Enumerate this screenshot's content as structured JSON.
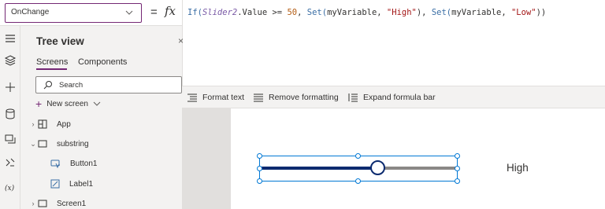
{
  "formula_bar": {
    "property": "OnChange",
    "equals": "=",
    "fx": "fx",
    "formula_tokens": [
      {
        "text": "If(",
        "style": "kw"
      },
      {
        "text": "Slider2",
        "style": "ctl"
      },
      {
        "text": ".Value >= ",
        "style": "plain"
      },
      {
        "text": "50",
        "style": "num"
      },
      {
        "text": ", ",
        "style": "plain"
      },
      {
        "text": "Set(",
        "style": "kw"
      },
      {
        "text": "myVariable, ",
        "style": "plain"
      },
      {
        "text": "\"High\"",
        "style": "str"
      },
      {
        "text": "), ",
        "style": "plain"
      },
      {
        "text": "Set(",
        "style": "kw"
      },
      {
        "text": "myVariable, ",
        "style": "plain"
      },
      {
        "text": "\"Low\"",
        "style": "str"
      },
      {
        "text": "))",
        "style": "plain"
      }
    ],
    "toolbar": {
      "format_text": "Format text",
      "remove_formatting": "Remove formatting",
      "expand_formula_bar": "Expand formula bar"
    }
  },
  "tree_view": {
    "title": "Tree view",
    "close": "×",
    "tabs": {
      "screens": "Screens",
      "components": "Components"
    },
    "search_placeholder": "Search",
    "new_screen": "New screen",
    "items": [
      {
        "label": "App",
        "icon": "app-icon",
        "indent": 0,
        "expander": "›"
      },
      {
        "label": "substring",
        "icon": "screen-icon",
        "indent": 0,
        "expander": "⌄"
      },
      {
        "label": "Button1",
        "icon": "button-icon",
        "indent": 1,
        "expander": ""
      },
      {
        "label": "Label1",
        "icon": "label-icon",
        "indent": 1,
        "expander": ""
      },
      {
        "label": "Screen1",
        "icon": "screen-icon",
        "indent": 0,
        "expander": "›"
      }
    ]
  },
  "canvas": {
    "slider_value_fraction": 0.6,
    "label_text": "High"
  },
  "colors": {
    "accent": "#742774",
    "slider_fill": "#0b2a6f",
    "selection": "#0078d4"
  }
}
